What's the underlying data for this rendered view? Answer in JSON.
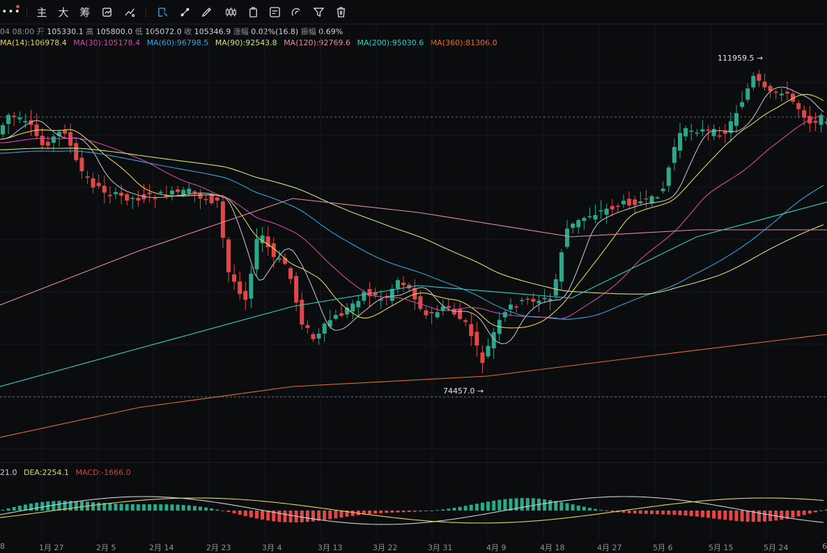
{
  "toolbar": {
    "more_label": "•••",
    "main_label": "主",
    "large_label": "大",
    "chip_label": "筹"
  },
  "info": {
    "time": "04 08:00",
    "open_label": "开",
    "open": "105330.1",
    "high_label": "高",
    "high": "105800.0",
    "low_label": "低",
    "low": "105072.0",
    "close_label": "收",
    "close": "105346.9",
    "change_label": "涨幅",
    "change": "0.02%(16.8)",
    "amplitude_label": "振幅",
    "amplitude": "0.69%"
  },
  "ma_legend": [
    {
      "text": "MA(14):106978.4",
      "color": "#e8d55a"
    },
    {
      "text": "MA(30):105178.4",
      "color": "#d14ba8"
    },
    {
      "text": "MA(60):96798.5",
      "color": "#35a3dd"
    },
    {
      "text": "MA(90):92543.8",
      "color": "#d3e27a"
    },
    {
      "text": "MA(120):92769.6",
      "color": "#e58aa6"
    },
    {
      "text": "MA(200):95030.6",
      "color": "#2fd0c8"
    },
    {
      "text": "MA(360):81306.0",
      "color": "#e26e2c"
    }
  ],
  "price_marks": {
    "high": "111959.5 →",
    "low": "74457.0 →"
  },
  "macd_legend": [
    {
      "text": "21.0",
      "color": "#cfd3d8"
    },
    {
      "text": "DEA:2254.1",
      "color": "#e8d55a"
    },
    {
      "text": "MACD:-1666.0",
      "color": "#c9453e"
    }
  ],
  "date_axis": [
    "8",
    "1月 27",
    "2月 5",
    "2月 14",
    "2月 23",
    "3月 4",
    "3月 13",
    "3月 22",
    "3月 31",
    "4月 9",
    "4月 18",
    "4月 27",
    "5月 6",
    "5月 15",
    "5月 24",
    "6"
  ],
  "colors": {
    "up": "#2aa889",
    "down": "#e04848",
    "background": "#0b0c0e"
  }
}
